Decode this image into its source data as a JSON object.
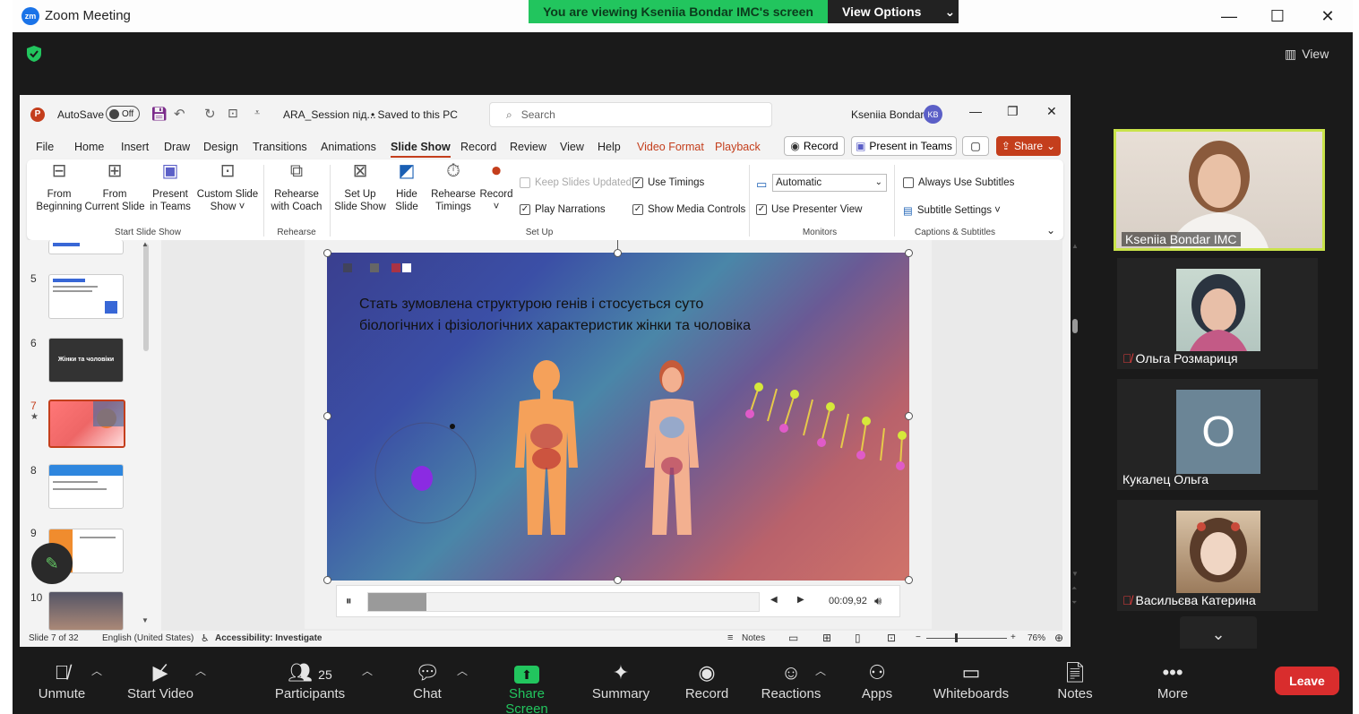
{
  "window": {
    "title": "Zoom Meeting",
    "logo": "zm"
  },
  "banner": {
    "viewing": "You are viewing Kseniia Bondar IMC's screen",
    "view_options": "View Options"
  },
  "view_button": "View",
  "ppt": {
    "autosave": "AutoSave",
    "autosave_state": "Off",
    "filename": "ARA_Session під...",
    "saved": "• Saved to this PC",
    "search_placeholder": "Search",
    "user": "Kseniia Bondar",
    "user_initials": "KB",
    "tabs": [
      "File",
      "Home",
      "Insert",
      "Draw",
      "Design",
      "Transitions",
      "Animations",
      "Slide Show",
      "Record",
      "Review",
      "View",
      "Help",
      "Video Format",
      "Playback"
    ],
    "active_tab": "Slide Show",
    "record_btn": "Record",
    "present_teams_btn": "Present in Teams",
    "share_btn": "Share",
    "ribbon": {
      "from_beginning": [
        "From",
        "Beginning"
      ],
      "from_current": [
        "From",
        "Current Slide"
      ],
      "present_teams": [
        "Present",
        "in Teams"
      ],
      "custom_show": [
        "Custom Slide",
        "Show ˅"
      ],
      "group_start": "Start Slide Show",
      "rehearse_coach": [
        "Rehearse",
        "with Coach"
      ],
      "group_rehearse": "Rehearse",
      "setup_show": [
        "Set Up",
        "Slide Show"
      ],
      "hide_slide": [
        "Hide",
        "Slide"
      ],
      "rehearse_timings": [
        "Rehearse",
        "Timings"
      ],
      "record": [
        "Record",
        "˅"
      ],
      "keep_updated": "Keep Slides Updated",
      "play_narrations": "Play Narrations",
      "use_timings": "Use Timings",
      "show_media": "Show Media Controls",
      "group_setup": "Set Up",
      "monitor_select": "Automatic",
      "presenter_view": "Use Presenter View",
      "group_monitors": "Monitors",
      "always_subtitles": "Always Use Subtitles",
      "subtitle_settings": "Subtitle Settings ˅",
      "group_captions": "Captions & Subtitles"
    },
    "thumbnails": [
      {
        "num": "5"
      },
      {
        "num": "6",
        "text": "Жінки та чоловіки"
      },
      {
        "num": "7"
      },
      {
        "num": "8"
      },
      {
        "num": "9"
      },
      {
        "num": "10"
      }
    ],
    "slide": {
      "line1": "Стать зумовлена структурою генів і стосується суто",
      "line2": "біологічних і фізіологічних характеристик жінки та чоловіка"
    },
    "media": {
      "time": "00:09,92",
      "progress": 0.15
    },
    "status": {
      "slide": "Slide 7 of 32",
      "language": "English (United States)",
      "accessibility": "Accessibility: Investigate",
      "notes": "Notes",
      "zoom": "76%"
    }
  },
  "participants": [
    {
      "name": "Kseniia Bondar IMC",
      "muted": false,
      "active": true
    },
    {
      "name": "Ольга Розмариця",
      "muted": true
    },
    {
      "name": "Кукалец Ольга",
      "muted": false,
      "initial": "O"
    },
    {
      "name": "Васильєва Катерина",
      "muted": true
    }
  ],
  "toolbar": {
    "unmute": "Unmute",
    "start_video": "Start Video",
    "participants": "Participants",
    "participants_count": "25",
    "chat": "Chat",
    "share_screen": "Share Screen",
    "summary": "Summary",
    "record": "Record",
    "reactions": "Reactions",
    "apps": "Apps",
    "whiteboards": "Whiteboards",
    "notes": "Notes",
    "more": "More",
    "leave": "Leave"
  },
  "colors": {
    "share_green": "#22c55e",
    "leave_red": "#d92d2d",
    "active_speaker": "#c9e34a",
    "ppt_accent": "#c43e1c"
  }
}
